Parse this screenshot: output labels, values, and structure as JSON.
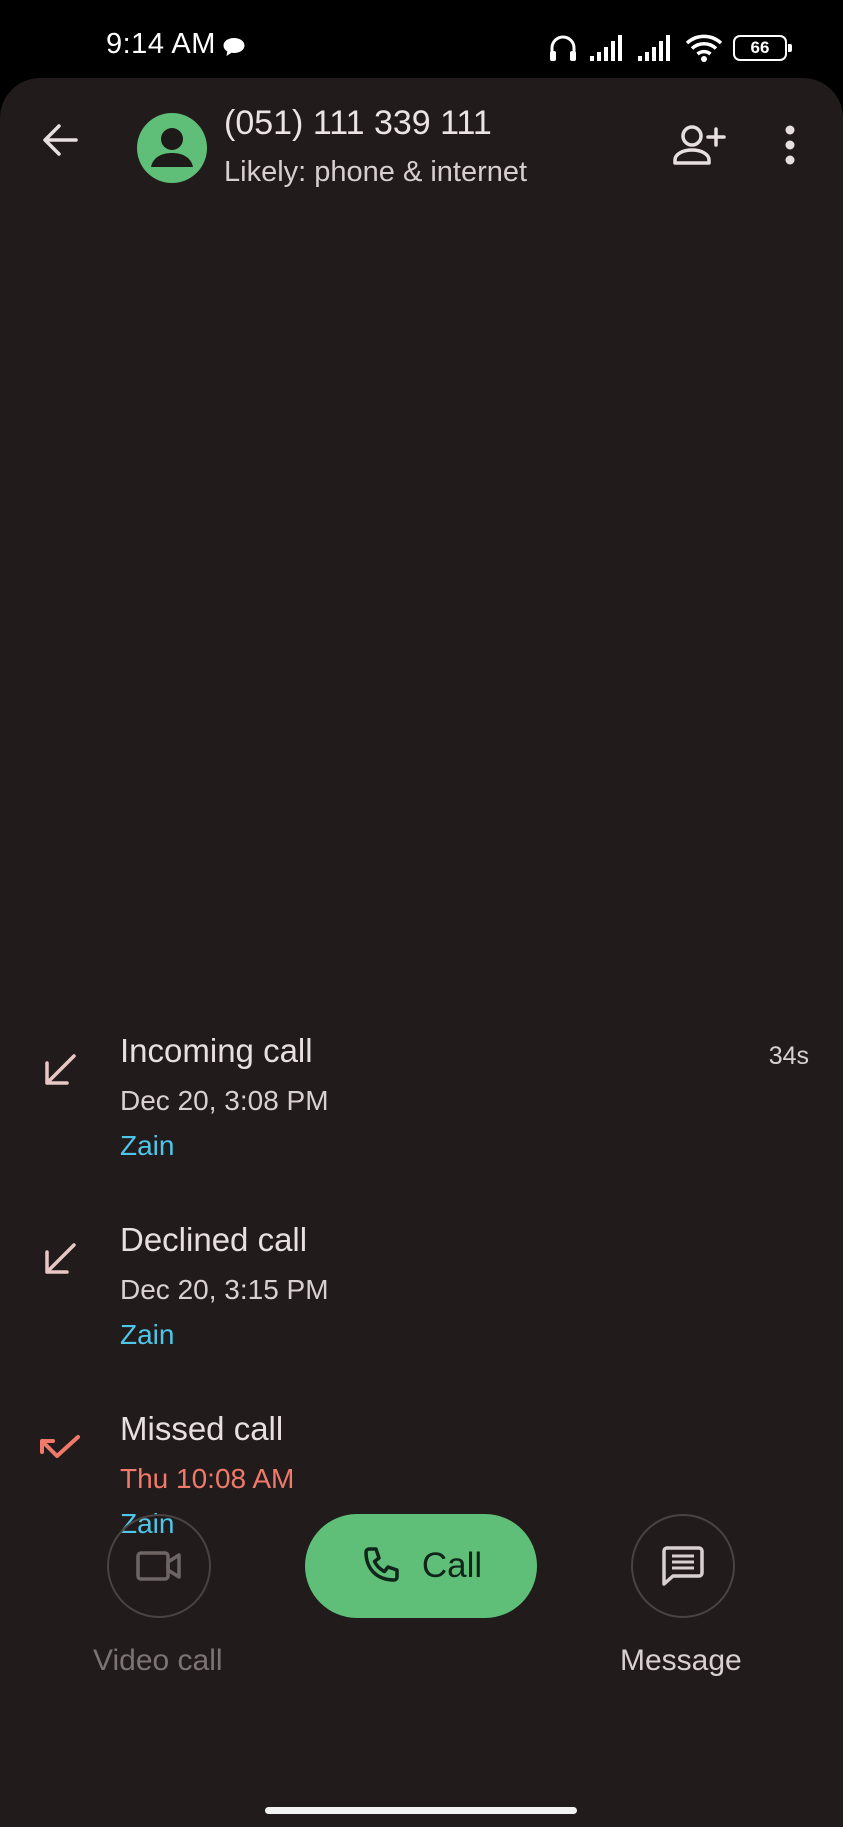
{
  "status_bar": {
    "time": "9:14 AM",
    "battery": "66",
    "icons": [
      "chat-bubble-icon",
      "headphones-icon",
      "signal-icon",
      "signal-icon",
      "wifi-icon",
      "battery-icon"
    ]
  },
  "header": {
    "number": "(051) 111 339 111",
    "subtitle": "Likely: phone & internet",
    "avatar_color": "#5fbf78"
  },
  "calls": [
    {
      "type": "Incoming call",
      "time": "Dec 20, 3:08 PM",
      "sim": "Zain",
      "duration": "34s",
      "icon": "incoming-call-icon",
      "missed": false
    },
    {
      "type": "Declined call",
      "time": "Dec 20, 3:15 PM",
      "sim": "Zain",
      "duration": "",
      "icon": "incoming-call-icon",
      "missed": false
    },
    {
      "type": "Missed call",
      "time": "Thu 10:08 AM",
      "sim": "Zain",
      "duration": "",
      "icon": "missed-call-icon",
      "missed": true
    }
  ],
  "actions": {
    "video_call": "Video call",
    "call": "Call",
    "message": "Message"
  },
  "colors": {
    "background": "#211b1b",
    "accent_green": "#5fbf78",
    "sim_blue": "#4fc6e8",
    "missed_red": "#f07a6a"
  }
}
